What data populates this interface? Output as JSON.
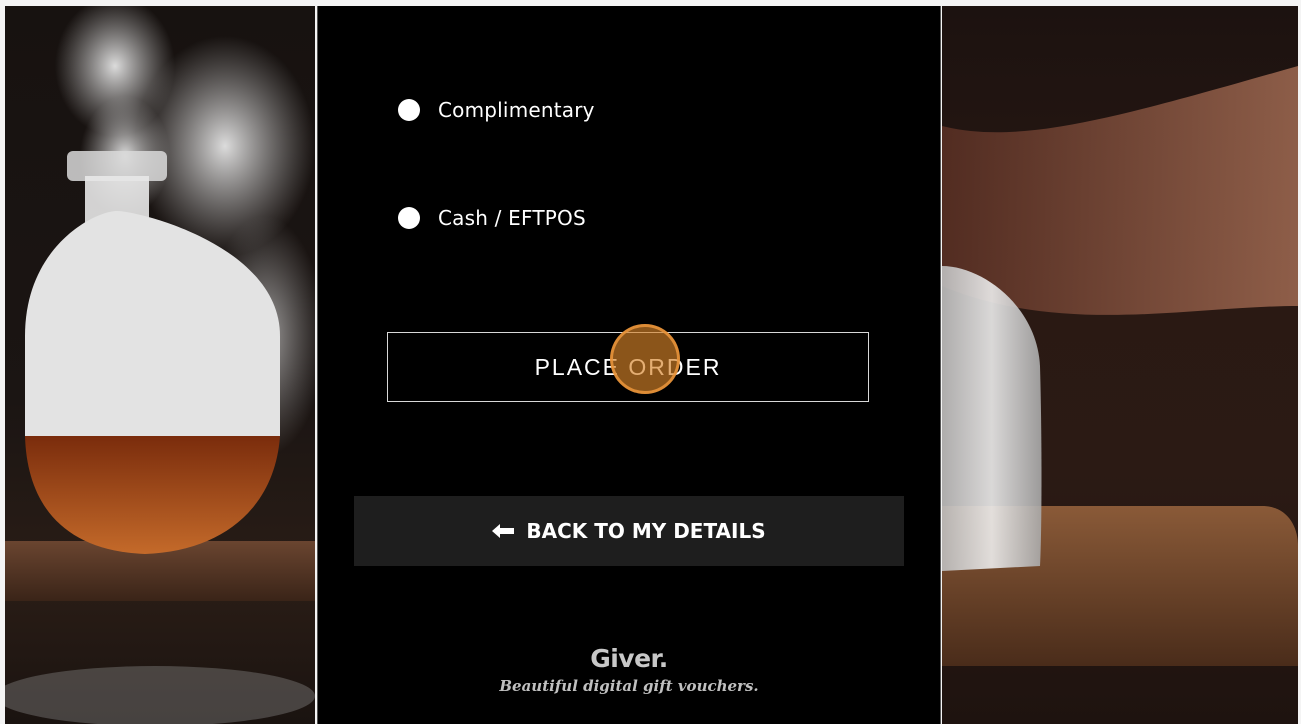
{
  "payment_options": [
    {
      "label": "Complimentary"
    },
    {
      "label": "Cash / EFTPOS"
    }
  ],
  "place_order_label": "PLACE ORDER",
  "back_button": {
    "arrow": "←",
    "label": "BACK TO MY DETAILS"
  },
  "brand": {
    "name": "Giver.",
    "tagline": "Beautiful digital gift vouchers."
  },
  "colors": {
    "panel_background": "#000000",
    "back_button_background": "#1e1e1e",
    "click_marker": "#d68228"
  },
  "decorative_photos": {
    "left": "smoking-flask-photo",
    "right": "glass-on-board-photo"
  }
}
